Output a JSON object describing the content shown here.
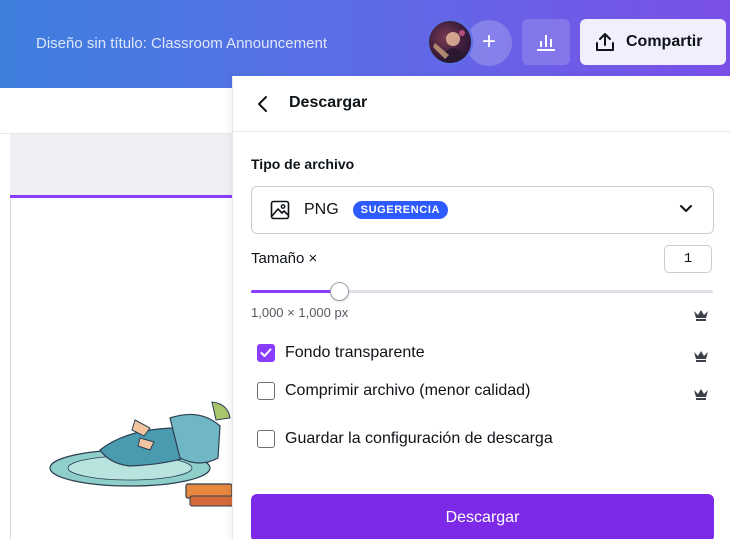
{
  "topbar": {
    "doc_title": "Diseño sin título: Classroom Announcement",
    "plus_label": "+",
    "share_label": "Compartir"
  },
  "panel": {
    "title": "Descargar",
    "file_type_label": "Tipo de archivo",
    "file_type_value": "PNG",
    "file_type_badge": "SUGERENCIA",
    "size_label": "Tamaño ×",
    "size_value": "1",
    "size_slider_fraction": 0.19,
    "dimensions": "1,000 × 1,000 px",
    "options": [
      {
        "label": "Fondo transparente",
        "checked": true,
        "premium": true
      },
      {
        "label": "Comprimir archivo (menor calidad)",
        "checked": false,
        "premium": true
      },
      {
        "label": "Guardar la configuración de descarga",
        "checked": false,
        "premium": false
      }
    ],
    "download_label": "Descargar"
  },
  "colors": {
    "accent": "#8b3dff",
    "button": "#7d2ae8",
    "badge": "#2e5bff"
  },
  "icons": {
    "back": "chevron-left-icon",
    "file_type": "image-icon",
    "dropdown": "chevron-down-icon",
    "stats": "bar-chart-icon",
    "share": "upload-icon",
    "premium": "crown-icon"
  }
}
